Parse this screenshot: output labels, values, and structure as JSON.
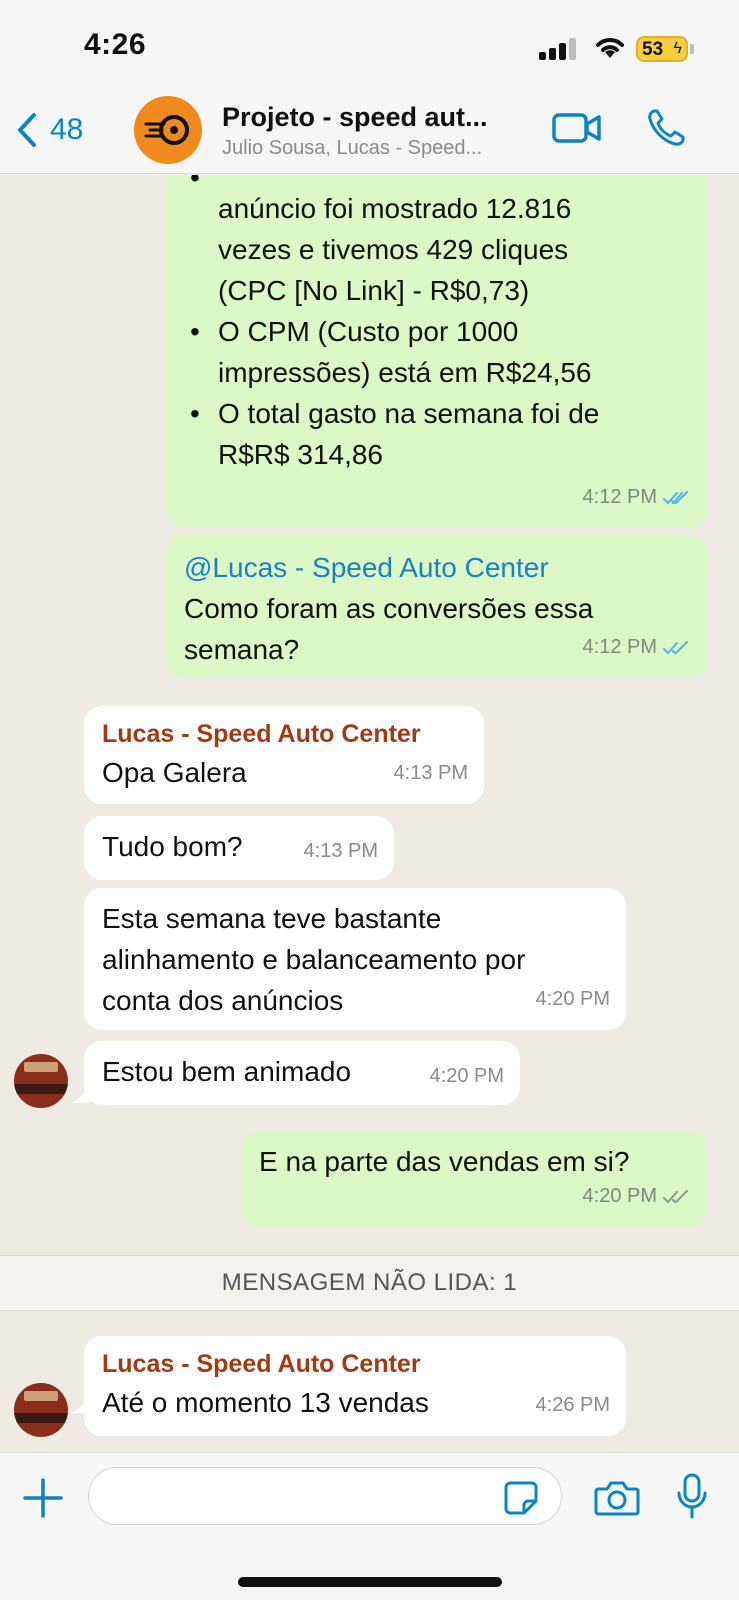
{
  "status_bar": {
    "time": "4:26",
    "battery": "53"
  },
  "header": {
    "back_count": "48",
    "title": "Projeto - speed aut...",
    "subtitle": "Julio Sousa, Lucas - Speed..."
  },
  "messages": {
    "m1": {
      "lines": [
        "anúncio foi mostrado 12.816",
        "vezes e tivemos 429 cliques",
        "(CPC [No Link] - R$0,73)"
      ],
      "bullet2": "O CPM (Custo por 1000 impressões) está em R$24,56",
      "bullet3": "O total gasto na semana foi de R$R$ 314,86",
      "time": "4:12 PM"
    },
    "m2": {
      "mention": "@Lucas - Speed Auto Center",
      "text": "Como foram as conversões essa semana?",
      "time": "4:12 PM"
    },
    "m3": {
      "sender": "Lucas - Speed Auto Center",
      "text": "Opa Galera",
      "time": "4:13 PM"
    },
    "m4": {
      "text": "Tudo bom?",
      "time": "4:13 PM"
    },
    "m5": {
      "text": "Esta semana teve bastante alinhamento e balanceamento por conta dos anúncios",
      "time": "4:20 PM"
    },
    "m6": {
      "text": "Estou bem animado",
      "time": "4:20 PM"
    },
    "m7": {
      "text": "E na parte das vendas em si?",
      "time": "4:20 PM"
    },
    "unread": "MENSAGEM NÃO LIDA: 1",
    "m8": {
      "sender": "Lucas - Speed Auto Center",
      "text": "Até o momento 13 vendas",
      "time": "4:26 PM"
    }
  },
  "input": {
    "placeholder": ""
  },
  "colors": {
    "accent": "#0a84c8",
    "outgoing": "#dcf8c6",
    "incoming": "#ffffff",
    "sender": "#a33a13",
    "read_ticks": "#4fb6ec"
  }
}
